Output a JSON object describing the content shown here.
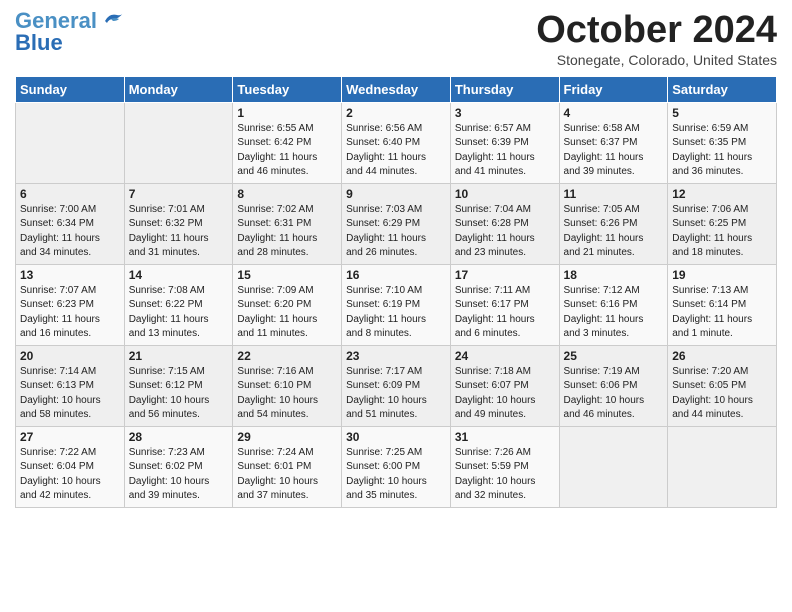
{
  "header": {
    "logo_general": "General",
    "logo_blue": "Blue",
    "month": "October 2024",
    "location": "Stonegate, Colorado, United States"
  },
  "days_of_week": [
    "Sunday",
    "Monday",
    "Tuesday",
    "Wednesday",
    "Thursday",
    "Friday",
    "Saturday"
  ],
  "weeks": [
    [
      {
        "day": "",
        "info": ""
      },
      {
        "day": "",
        "info": ""
      },
      {
        "day": "1",
        "info": "Sunrise: 6:55 AM\nSunset: 6:42 PM\nDaylight: 11 hours\nand 46 minutes."
      },
      {
        "day": "2",
        "info": "Sunrise: 6:56 AM\nSunset: 6:40 PM\nDaylight: 11 hours\nand 44 minutes."
      },
      {
        "day": "3",
        "info": "Sunrise: 6:57 AM\nSunset: 6:39 PM\nDaylight: 11 hours\nand 41 minutes."
      },
      {
        "day": "4",
        "info": "Sunrise: 6:58 AM\nSunset: 6:37 PM\nDaylight: 11 hours\nand 39 minutes."
      },
      {
        "day": "5",
        "info": "Sunrise: 6:59 AM\nSunset: 6:35 PM\nDaylight: 11 hours\nand 36 minutes."
      }
    ],
    [
      {
        "day": "6",
        "info": "Sunrise: 7:00 AM\nSunset: 6:34 PM\nDaylight: 11 hours\nand 34 minutes."
      },
      {
        "day": "7",
        "info": "Sunrise: 7:01 AM\nSunset: 6:32 PM\nDaylight: 11 hours\nand 31 minutes."
      },
      {
        "day": "8",
        "info": "Sunrise: 7:02 AM\nSunset: 6:31 PM\nDaylight: 11 hours\nand 28 minutes."
      },
      {
        "day": "9",
        "info": "Sunrise: 7:03 AM\nSunset: 6:29 PM\nDaylight: 11 hours\nand 26 minutes."
      },
      {
        "day": "10",
        "info": "Sunrise: 7:04 AM\nSunset: 6:28 PM\nDaylight: 11 hours\nand 23 minutes."
      },
      {
        "day": "11",
        "info": "Sunrise: 7:05 AM\nSunset: 6:26 PM\nDaylight: 11 hours\nand 21 minutes."
      },
      {
        "day": "12",
        "info": "Sunrise: 7:06 AM\nSunset: 6:25 PM\nDaylight: 11 hours\nand 18 minutes."
      }
    ],
    [
      {
        "day": "13",
        "info": "Sunrise: 7:07 AM\nSunset: 6:23 PM\nDaylight: 11 hours\nand 16 minutes."
      },
      {
        "day": "14",
        "info": "Sunrise: 7:08 AM\nSunset: 6:22 PM\nDaylight: 11 hours\nand 13 minutes."
      },
      {
        "day": "15",
        "info": "Sunrise: 7:09 AM\nSunset: 6:20 PM\nDaylight: 11 hours\nand 11 minutes."
      },
      {
        "day": "16",
        "info": "Sunrise: 7:10 AM\nSunset: 6:19 PM\nDaylight: 11 hours\nand 8 minutes."
      },
      {
        "day": "17",
        "info": "Sunrise: 7:11 AM\nSunset: 6:17 PM\nDaylight: 11 hours\nand 6 minutes."
      },
      {
        "day": "18",
        "info": "Sunrise: 7:12 AM\nSunset: 6:16 PM\nDaylight: 11 hours\nand 3 minutes."
      },
      {
        "day": "19",
        "info": "Sunrise: 7:13 AM\nSunset: 6:14 PM\nDaylight: 11 hours\nand 1 minute."
      }
    ],
    [
      {
        "day": "20",
        "info": "Sunrise: 7:14 AM\nSunset: 6:13 PM\nDaylight: 10 hours\nand 58 minutes."
      },
      {
        "day": "21",
        "info": "Sunrise: 7:15 AM\nSunset: 6:12 PM\nDaylight: 10 hours\nand 56 minutes."
      },
      {
        "day": "22",
        "info": "Sunrise: 7:16 AM\nSunset: 6:10 PM\nDaylight: 10 hours\nand 54 minutes."
      },
      {
        "day": "23",
        "info": "Sunrise: 7:17 AM\nSunset: 6:09 PM\nDaylight: 10 hours\nand 51 minutes."
      },
      {
        "day": "24",
        "info": "Sunrise: 7:18 AM\nSunset: 6:07 PM\nDaylight: 10 hours\nand 49 minutes."
      },
      {
        "day": "25",
        "info": "Sunrise: 7:19 AM\nSunset: 6:06 PM\nDaylight: 10 hours\nand 46 minutes."
      },
      {
        "day": "26",
        "info": "Sunrise: 7:20 AM\nSunset: 6:05 PM\nDaylight: 10 hours\nand 44 minutes."
      }
    ],
    [
      {
        "day": "27",
        "info": "Sunrise: 7:22 AM\nSunset: 6:04 PM\nDaylight: 10 hours\nand 42 minutes."
      },
      {
        "day": "28",
        "info": "Sunrise: 7:23 AM\nSunset: 6:02 PM\nDaylight: 10 hours\nand 39 minutes."
      },
      {
        "day": "29",
        "info": "Sunrise: 7:24 AM\nSunset: 6:01 PM\nDaylight: 10 hours\nand 37 minutes."
      },
      {
        "day": "30",
        "info": "Sunrise: 7:25 AM\nSunset: 6:00 PM\nDaylight: 10 hours\nand 35 minutes."
      },
      {
        "day": "31",
        "info": "Sunrise: 7:26 AM\nSunset: 5:59 PM\nDaylight: 10 hours\nand 32 minutes."
      },
      {
        "day": "",
        "info": ""
      },
      {
        "day": "",
        "info": ""
      }
    ]
  ]
}
